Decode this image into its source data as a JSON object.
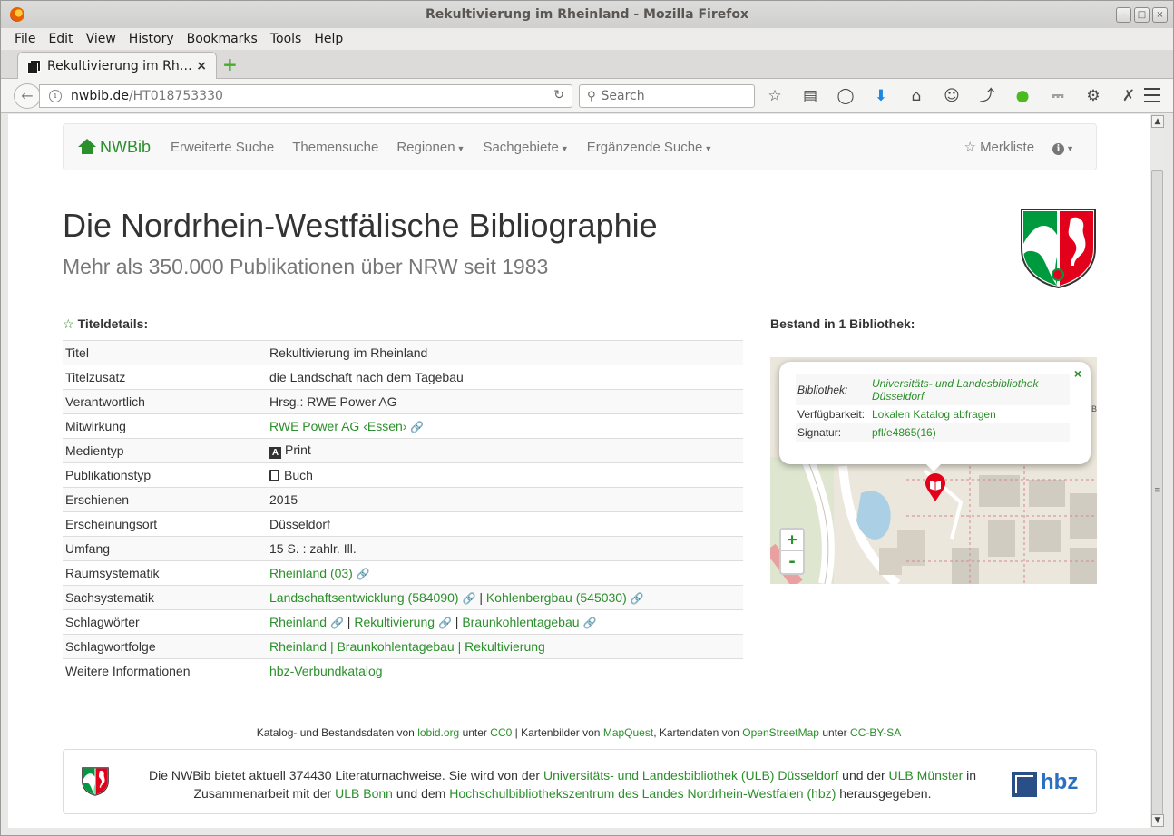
{
  "window": {
    "title": "Rekultivierung im Rheinland - Mozilla Firefox"
  },
  "menu": [
    "File",
    "Edit",
    "View",
    "History",
    "Bookmarks",
    "Tools",
    "Help"
  ],
  "tab": {
    "title": "Rekultivierung im Rh…",
    "close": "×"
  },
  "url": {
    "host": "nwbib.de",
    "path": "/HT018753330"
  },
  "search": {
    "placeholder": "Search"
  },
  "site_nav": {
    "brand": "NWBib",
    "items": [
      "Erweiterte Suche",
      "Themensuche",
      "Regionen",
      "Sachgebiete",
      "Ergänzende Suche"
    ],
    "merkliste": "Merkliste"
  },
  "header": {
    "title": "Die Nordrhein-Westfälische Bibliographie",
    "subtitle": "Mehr als 350.000 Publikationen über NRW seit 1983"
  },
  "details": {
    "heading": "Titeldetails:",
    "rows": {
      "titel": {
        "label": "Titel",
        "value": "Rekultivierung im Rheinland"
      },
      "zusatz": {
        "label": "Titelzusatz",
        "value": "die Landschaft nach dem Tagebau"
      },
      "verantw": {
        "label": "Verantwortlich",
        "value": "Hrsg.: RWE Power AG"
      },
      "mitwirkung": {
        "label": "Mitwirkung",
        "value": "RWE Power AG ‹Essen›"
      },
      "medientyp": {
        "label": "Medientyp",
        "value": "Print"
      },
      "pubtyp": {
        "label": "Publikationstyp",
        "value": "Buch"
      },
      "erschienen": {
        "label": "Erschienen",
        "value": "2015"
      },
      "ort": {
        "label": "Erscheinungsort",
        "value": "Düsseldorf"
      },
      "umfang": {
        "label": "Umfang",
        "value": "15 S. : zahlr. Ill."
      },
      "raum": {
        "label": "Raumsystematik",
        "value": "Rheinland (03)"
      },
      "sach": {
        "label": "Sachsystematik",
        "links": [
          "Landschaftsentwicklung (584090)",
          "Kohlenbergbau (545030)"
        ]
      },
      "schlag": {
        "label": "Schlagwörter",
        "links": [
          "Rheinland",
          "Rekultivierung",
          "Braunkohlentagebau"
        ]
      },
      "folge": {
        "label": "Schlagwortfolge",
        "value": "Rheinland | Braunkohlentagebau | Rekultivierung"
      },
      "weitere": {
        "label": "Weitere Informationen",
        "value": "hbz-Verbundkatalog"
      }
    }
  },
  "bestand": {
    "heading": "Bestand in 1 Bibliothek:",
    "popup": {
      "bibliothek_label": "Bibliothek:",
      "bibliothek_value": "Universitäts- und Landesbibliothek Düsseldorf",
      "verfuegbarkeit_label": "Verfügbarkeit:",
      "verfuegbarkeit_value": "Lokalen Katalog abfragen",
      "signatur_label": "Signatur:",
      "signatur_value": "pfl/e4865(16)",
      "close": "×"
    },
    "map_label": "er B",
    "zoom_in": "+",
    "zoom_out": "-"
  },
  "attribution": {
    "t1": "Katalog- und Bestandsdaten von",
    "l1": "lobid.org",
    "t2": "unter",
    "l2": "CC0",
    "t3": "| Kartenbilder von",
    "l3": "MapQuest",
    "t4": ", Kartendaten von",
    "l4": "OpenStreetMap",
    "t5": "unter",
    "l5": "CC-BY-SA"
  },
  "footer": {
    "t1": "Die NWBib bietet aktuell 374430 Literaturnachweise. Sie wird von der",
    "l1": "Universitäts- und Landesbibliothek (ULB) Düsseldorf",
    "t2": "und der",
    "l2": "ULB Münster",
    "t3": "in Zusammenarbeit mit der",
    "l3": "ULB Bonn",
    "t4": "und dem",
    "l4": "Hochschulbibliothekszentrum des Landes Nordrhein-Westfalen (hbz)",
    "t5": "herausgegeben.",
    "logo": "hbz"
  },
  "colors": {
    "accent_green": "#2b8f2b",
    "nrw_red": "#e2001a",
    "nrw_green": "#009a3e",
    "hbz_blue": "#2a6fc0"
  }
}
